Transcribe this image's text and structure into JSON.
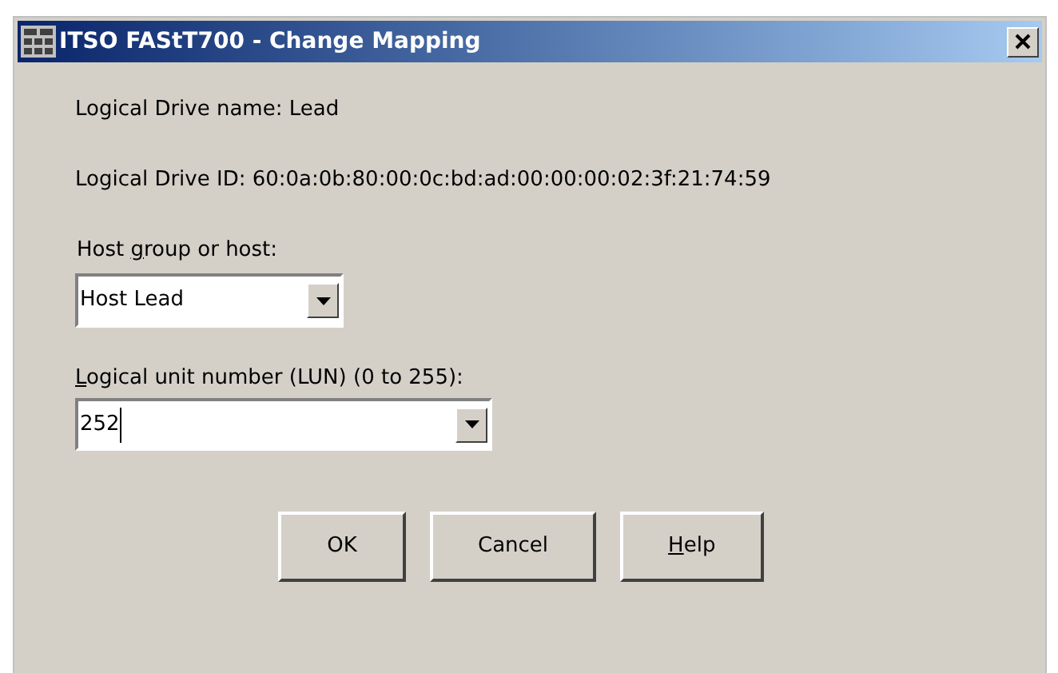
{
  "window": {
    "title": "ITSO FAStT700 - Change Mapping"
  },
  "info": [
    "Logical Drive name: Lead",
    "Logical Drive ID: 60:0a:0b:80:00:0c:bd:ad:00:00:00:02:3f:21:74:59"
  ],
  "host_field": {
    "label": {
      "before": "Host ",
      "key": "g",
      "after": "roup or host:"
    },
    "value": "Host Lead"
  },
  "lun_field": {
    "label": {
      "key": "L",
      "after": "ogical unit number (LUN) (0 to 255):"
    },
    "value": "252",
    "focused": true
  },
  "buttons": [
    {
      "label": {
        "after": "OK"
      }
    },
    {
      "label": {
        "after": "Cancel"
      }
    },
    {
      "label": {
        "key": "H",
        "after": "elp"
      }
    }
  ]
}
